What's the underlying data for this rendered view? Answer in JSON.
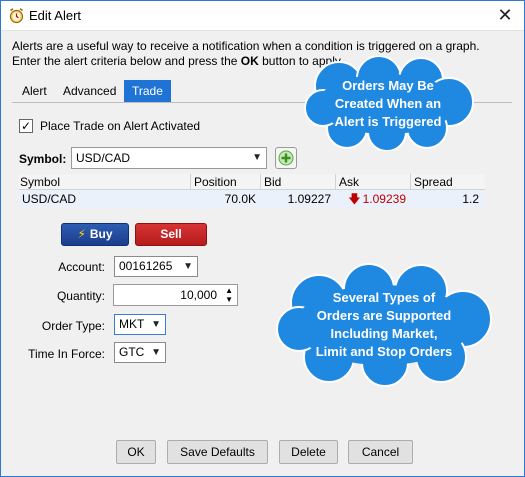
{
  "window": {
    "title": "Edit Alert",
    "close_glyph": "✕"
  },
  "intro": {
    "line1": "Alerts are a useful way to receive a notification when a condition is triggered on a graph.",
    "line2_pre": "Enter the alert criteria below and press the ",
    "line2_bold": "OK",
    "line2_post": " button to apply"
  },
  "tabs": [
    {
      "label": "Alert",
      "active": false
    },
    {
      "label": "Advanced",
      "active": false
    },
    {
      "label": "Trade",
      "active": true
    }
  ],
  "trade": {
    "place_trade_checked": true,
    "place_trade_label": "Place Trade on Alert Activated",
    "symbol_label": "Symbol:",
    "symbol_value": "USD/CAD",
    "grid": {
      "headers": [
        "Symbol",
        "Position",
        "Bid",
        "Ask",
        "Spread"
      ],
      "row": {
        "symbol": "USD/CAD",
        "position": "70.0K",
        "bid": "1.09227",
        "ask": "1.09239",
        "spread": "1.2"
      }
    },
    "buy_label": "Buy",
    "sell_label": "Sell",
    "account_label": "Account:",
    "account_value": "00161265",
    "quantity_label": "Quantity:",
    "quantity_value": "10,000",
    "order_type_label": "Order Type:",
    "order_type_value": "MKT",
    "tif_label": "Time In Force:",
    "tif_value": "GTC"
  },
  "callouts": {
    "top_line1": "Orders May Be",
    "top_line2": "Created When an",
    "top_line3": "Alert is Triggered",
    "mid_line1": "Several Types of",
    "mid_line2": "Orders are Supported",
    "mid_line3": "Including Market,",
    "mid_line4": "Limit and Stop Orders"
  },
  "footer": {
    "ok": "OK",
    "save_defaults": "Save Defaults",
    "delete": "Delete",
    "cancel": "Cancel"
  },
  "colors": {
    "accent": "#1e73d4",
    "bubble": "#1f88e0",
    "buy": "#2d5db2",
    "sell": "#c62828",
    "ask_down": "#c00000"
  },
  "icons": {
    "title": "alarm-clock-icon",
    "add": "plus-icon",
    "ask_direction": "down-arrow-icon",
    "buy": "lightning-icon"
  }
}
